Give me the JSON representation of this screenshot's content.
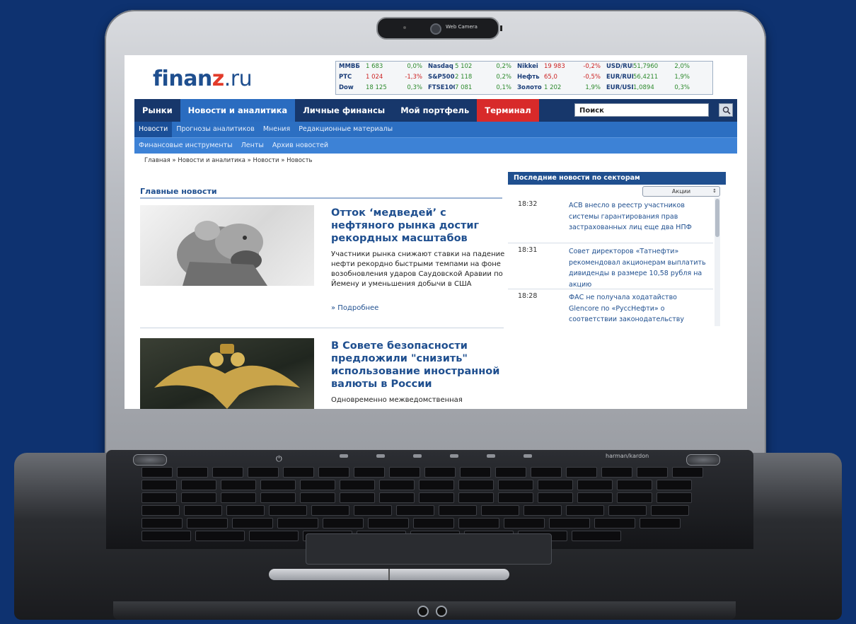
{
  "camera": {
    "label": "Web Camera"
  },
  "site": {
    "logo": {
      "main": "finan",
      "accent": "z",
      "tld": ".ru"
    },
    "ticker": [
      [
        {
          "name": "ММВБ",
          "value": "1 683",
          "pct": "0,0%",
          "neg": false
        },
        {
          "name": "Nasdaq",
          "value": "5 102",
          "pct": "0,2%",
          "neg": false
        },
        {
          "name": "Nikkei",
          "value": "19 983",
          "pct": "-0,2%",
          "neg": true
        },
        {
          "name": "USD/RUB",
          "value": "51,7960",
          "pct": "2,0%",
          "neg": false
        }
      ],
      [
        {
          "name": "РТС",
          "value": "1 024",
          "pct": "-1,3%",
          "neg": true
        },
        {
          "name": "S&P500",
          "value": "2 118",
          "pct": "0,2%",
          "neg": false
        },
        {
          "name": "Нефть",
          "value": "65,0",
          "pct": "-0,5%",
          "neg": true
        },
        {
          "name": "EUR/RUB",
          "value": "56,4211",
          "pct": "1,9%",
          "neg": false
        }
      ],
      [
        {
          "name": "Dow",
          "value": "18 125",
          "pct": "0,3%",
          "neg": false
        },
        {
          "name": "FTSE100",
          "value": "7 081",
          "pct": "0,1%",
          "neg": false
        },
        {
          "name": "Золото",
          "value": "1 202",
          "pct": "1,9%",
          "neg": false
        },
        {
          "name": "EUR/USD",
          "value": "1,0894",
          "pct": "0,3%",
          "neg": false
        }
      ]
    ],
    "nav": [
      "Рынки",
      "Новости и аналитика",
      "Личные финансы",
      "Мой портфель",
      "Терминал"
    ],
    "search": {
      "value": "Поиск"
    },
    "subnav": [
      "Новости",
      "Прогнозы аналитиков",
      "Мнения",
      "Редакционные материалы"
    ],
    "subnav2": [
      "Финансовые инструменты",
      "Ленты",
      "Архив новостей"
    ],
    "breadcrumb": "Главная » Новости и аналитика » Новости » Новость",
    "section_title": "Главные новости",
    "articles": [
      {
        "title": "Отток ‘медведей’ с нефтяного рынка достиг рекордных масштабов",
        "text": "Участники рынка снижают ставки на падение нефти рекордно быстрыми темпами на фоне возобновления ударов Саудовской Аравии по Йемену и уменьшения добычи в США",
        "more": "» Подробнее"
      },
      {
        "title": "В Совете безопасности предложили \"снизить\" использование иностранной валюты в России",
        "text": "Одновременно межведомственная"
      }
    ],
    "side": {
      "title": "Последние новости по секторам",
      "select": "Акции",
      "news": [
        {
          "time": "18:32",
          "text": "АСВ внесло в реестр участников системы гарантирования прав застрахованных лиц еще два НПФ"
        },
        {
          "time": "18:31",
          "text": "Совет директоров «Татнефти» рекомендовал акционерам выплатить дивиденды в размере 10,58 рубля на акцию"
        },
        {
          "time": "18:28",
          "text": "ФАС не получала ходатайство Glencore по «РуссНефти» о соответствии законодательству"
        }
      ]
    }
  },
  "laptop": {
    "brand": "harman/kardon"
  }
}
